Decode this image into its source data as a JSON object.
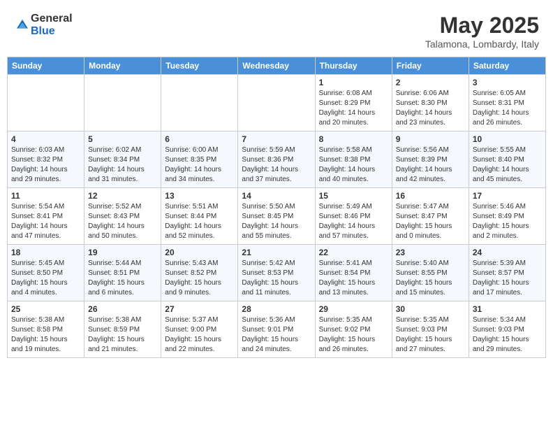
{
  "header": {
    "logo_general": "General",
    "logo_blue": "Blue",
    "month": "May 2025",
    "location": "Talamona, Lombardy, Italy"
  },
  "weekdays": [
    "Sunday",
    "Monday",
    "Tuesday",
    "Wednesday",
    "Thursday",
    "Friday",
    "Saturday"
  ],
  "weeks": [
    [
      null,
      null,
      null,
      null,
      {
        "day": "1",
        "sunrise": "6:08 AM",
        "sunset": "8:29 PM",
        "daylight": "14 hours and 20 minutes."
      },
      {
        "day": "2",
        "sunrise": "6:06 AM",
        "sunset": "8:30 PM",
        "daylight": "14 hours and 23 minutes."
      },
      {
        "day": "3",
        "sunrise": "6:05 AM",
        "sunset": "8:31 PM",
        "daylight": "14 hours and 26 minutes."
      }
    ],
    [
      {
        "day": "4",
        "sunrise": "6:03 AM",
        "sunset": "8:32 PM",
        "daylight": "14 hours and 29 minutes."
      },
      {
        "day": "5",
        "sunrise": "6:02 AM",
        "sunset": "8:34 PM",
        "daylight": "14 hours and 31 minutes."
      },
      {
        "day": "6",
        "sunrise": "6:00 AM",
        "sunset": "8:35 PM",
        "daylight": "14 hours and 34 minutes."
      },
      {
        "day": "7",
        "sunrise": "5:59 AM",
        "sunset": "8:36 PM",
        "daylight": "14 hours and 37 minutes."
      },
      {
        "day": "8",
        "sunrise": "5:58 AM",
        "sunset": "8:38 PM",
        "daylight": "14 hours and 40 minutes."
      },
      {
        "day": "9",
        "sunrise": "5:56 AM",
        "sunset": "8:39 PM",
        "daylight": "14 hours and 42 minutes."
      },
      {
        "day": "10",
        "sunrise": "5:55 AM",
        "sunset": "8:40 PM",
        "daylight": "14 hours and 45 minutes."
      }
    ],
    [
      {
        "day": "11",
        "sunrise": "5:54 AM",
        "sunset": "8:41 PM",
        "daylight": "14 hours and 47 minutes."
      },
      {
        "day": "12",
        "sunrise": "5:52 AM",
        "sunset": "8:43 PM",
        "daylight": "14 hours and 50 minutes."
      },
      {
        "day": "13",
        "sunrise": "5:51 AM",
        "sunset": "8:44 PM",
        "daylight": "14 hours and 52 minutes."
      },
      {
        "day": "14",
        "sunrise": "5:50 AM",
        "sunset": "8:45 PM",
        "daylight": "14 hours and 55 minutes."
      },
      {
        "day": "15",
        "sunrise": "5:49 AM",
        "sunset": "8:46 PM",
        "daylight": "14 hours and 57 minutes."
      },
      {
        "day": "16",
        "sunrise": "5:47 AM",
        "sunset": "8:47 PM",
        "daylight": "15 hours and 0 minutes."
      },
      {
        "day": "17",
        "sunrise": "5:46 AM",
        "sunset": "8:49 PM",
        "daylight": "15 hours and 2 minutes."
      }
    ],
    [
      {
        "day": "18",
        "sunrise": "5:45 AM",
        "sunset": "8:50 PM",
        "daylight": "15 hours and 4 minutes."
      },
      {
        "day": "19",
        "sunrise": "5:44 AM",
        "sunset": "8:51 PM",
        "daylight": "15 hours and 6 minutes."
      },
      {
        "day": "20",
        "sunrise": "5:43 AM",
        "sunset": "8:52 PM",
        "daylight": "15 hours and 9 minutes."
      },
      {
        "day": "21",
        "sunrise": "5:42 AM",
        "sunset": "8:53 PM",
        "daylight": "15 hours and 11 minutes."
      },
      {
        "day": "22",
        "sunrise": "5:41 AM",
        "sunset": "8:54 PM",
        "daylight": "15 hours and 13 minutes."
      },
      {
        "day": "23",
        "sunrise": "5:40 AM",
        "sunset": "8:55 PM",
        "daylight": "15 hours and 15 minutes."
      },
      {
        "day": "24",
        "sunrise": "5:39 AM",
        "sunset": "8:57 PM",
        "daylight": "15 hours and 17 minutes."
      }
    ],
    [
      {
        "day": "25",
        "sunrise": "5:38 AM",
        "sunset": "8:58 PM",
        "daylight": "15 hours and 19 minutes."
      },
      {
        "day": "26",
        "sunrise": "5:38 AM",
        "sunset": "8:59 PM",
        "daylight": "15 hours and 21 minutes."
      },
      {
        "day": "27",
        "sunrise": "5:37 AM",
        "sunset": "9:00 PM",
        "daylight": "15 hours and 22 minutes."
      },
      {
        "day": "28",
        "sunrise": "5:36 AM",
        "sunset": "9:01 PM",
        "daylight": "15 hours and 24 minutes."
      },
      {
        "day": "29",
        "sunrise": "5:35 AM",
        "sunset": "9:02 PM",
        "daylight": "15 hours and 26 minutes."
      },
      {
        "day": "30",
        "sunrise": "5:35 AM",
        "sunset": "9:03 PM",
        "daylight": "15 hours and 27 minutes."
      },
      {
        "day": "31",
        "sunrise": "5:34 AM",
        "sunset": "9:03 PM",
        "daylight": "15 hours and 29 minutes."
      }
    ]
  ]
}
